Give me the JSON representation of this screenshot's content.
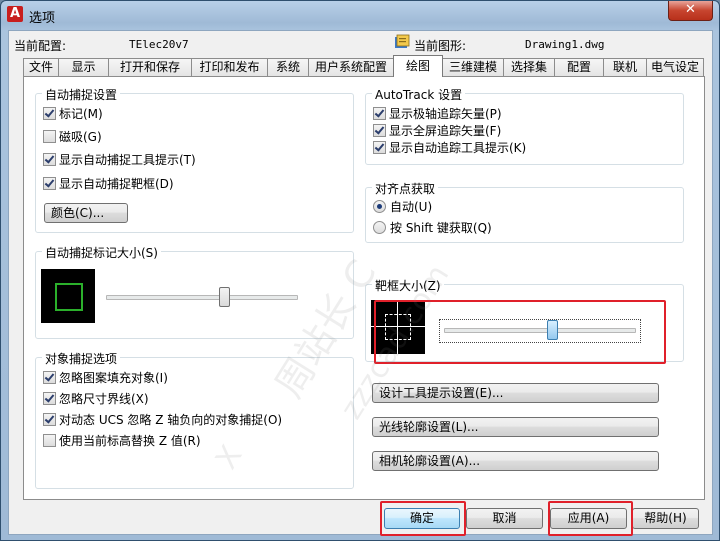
{
  "window": {
    "title": "选项",
    "app_icon": "A",
    "close_glyph": "✕"
  },
  "profile": {
    "current_profile_label": "当前配置:",
    "current_profile_value": "TElec20v7",
    "current_drawing_label": "当前图形:",
    "current_drawing_value": "Drawing1.dwg"
  },
  "tabs": [
    {
      "label": "文件"
    },
    {
      "label": "显示"
    },
    {
      "label": "打开和保存"
    },
    {
      "label": "打印和发布"
    },
    {
      "label": "系统"
    },
    {
      "label": "用户系统配置"
    },
    {
      "label": "绘图",
      "active": true
    },
    {
      "label": "三维建模"
    },
    {
      "label": "选择集"
    },
    {
      "label": "配置"
    },
    {
      "label": "联机"
    },
    {
      "label": "电气设定"
    }
  ],
  "autosnap": {
    "title": "自动捕捉设置",
    "marker": {
      "label": "标记(M)",
      "checked": true
    },
    "magnet": {
      "label": "磁吸(G)",
      "checked": false
    },
    "tooltip": {
      "label": "显示自动捕捉工具提示(T)",
      "checked": true
    },
    "aperture": {
      "label": "显示自动捕捉靶框(D)",
      "checked": true
    },
    "colors_button": "颜色(C)..."
  },
  "marker_size": {
    "title": "自动捕捉标记大小(S)",
    "slider_value": 0.62
  },
  "osnap_options": {
    "title": "对象捕捉选项",
    "ignore_hatch": {
      "label": "忽略图案填充对象(I)",
      "checked": true
    },
    "ignore_dimext": {
      "label": "忽略尺寸界线(X)",
      "checked": true
    },
    "dynamic_ucs": {
      "label": "对动态 UCS 忽略 Z 轴负向的对象捕捉(O)",
      "checked": true
    },
    "use_elevation": {
      "label": "使用当前标高替换 Z 值(R)",
      "checked": false
    }
  },
  "autotrack": {
    "title": "AutoTrack 设置",
    "polar_vector": {
      "label": "显示极轴追踪矢量(P)",
      "checked": true
    },
    "fullscreen_vector": {
      "label": "显示全屏追踪矢量(F)",
      "checked": true
    },
    "tracking_tooltip": {
      "label": "显示自动追踪工具提示(K)",
      "checked": true
    }
  },
  "alignment": {
    "title": "对齐点获取",
    "automatic": {
      "label": "自动(U)",
      "selected": true
    },
    "shift": {
      "label": "按 Shift 键获取(Q)",
      "selected": false
    }
  },
  "aperture_size": {
    "title": "靶框大小(Z)",
    "slider_value": 0.57
  },
  "right_buttons": {
    "design_tooltip": "设计工具提示设置(E)...",
    "lightglyph": "光线轮廓设置(L)...",
    "camera_glyph": "相机轮廓设置(A)..."
  },
  "footer": {
    "ok": "确定",
    "cancel": "取消",
    "apply": "应用(A)",
    "help": "帮助(H)"
  },
  "watermark": {
    "text1": "周站长 C",
    "text2": "zzzcad.com",
    "text3": "X"
  },
  "colors": {
    "marker_green": "#2bb02b",
    "highlight_red": "#e0202a",
    "preview_bg": "#000000"
  }
}
